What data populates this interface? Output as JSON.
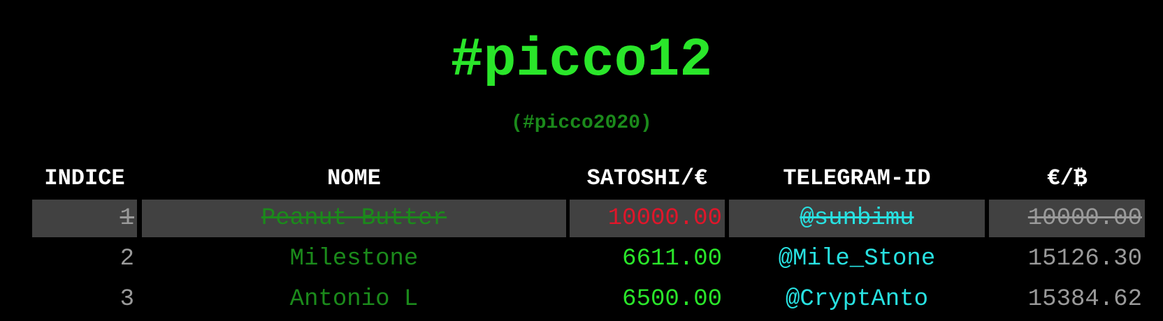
{
  "page": {
    "title": "#picco12",
    "subtitle": "(#picco2020)"
  },
  "table": {
    "columns": [
      "INDICE",
      "NOME",
      "SATOSHI/€",
      "TELEGRAM-ID",
      "€/₿"
    ],
    "rows": [
      {
        "index": "1",
        "name": "Peanut Butter",
        "satoshi": "10000.00",
        "telegram": "@sunbimu",
        "rate": "10000.00",
        "struck": true
      },
      {
        "index": "2",
        "name": "Milestone",
        "satoshi": "6611.00",
        "telegram": "@Mile_Stone",
        "rate": "15126.30",
        "struck": false
      },
      {
        "index": "3",
        "name": "Antonio L",
        "satoshi": "6500.00",
        "telegram": "@CryptAnto",
        "rate": "15384.62",
        "struck": false
      }
    ]
  },
  "colors": {
    "background": "#000000",
    "title_green": "#2ae62a",
    "name_green": "#1b8a1b",
    "telegram_cyan": "#28e1e1",
    "struck_row_bg": "#414141",
    "struck_value_red": "#e0162a",
    "muted_gray": "#9a9a9a"
  }
}
